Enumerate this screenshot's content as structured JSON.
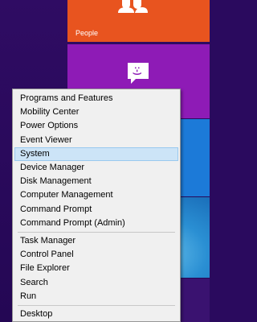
{
  "tiles": {
    "people": {
      "label": "People",
      "icon": "people-icon",
      "color": "#e8541f"
    },
    "messaging": {
      "icon": "messaging-icon",
      "emoticon": ":-)",
      "color": "#8e1bb6"
    },
    "photos": {
      "color": "#1c7ad8"
    }
  },
  "menu": {
    "group1": [
      "Programs and Features",
      "Mobility Center",
      "Power Options",
      "Event Viewer",
      "System",
      "Device Manager",
      "Disk Management",
      "Computer Management",
      "Command Prompt",
      "Command Prompt (Admin)"
    ],
    "group2": [
      "Task Manager",
      "Control Panel",
      "File Explorer",
      "Search",
      "Run"
    ],
    "group3": [
      "Desktop"
    ],
    "selected": "System"
  }
}
